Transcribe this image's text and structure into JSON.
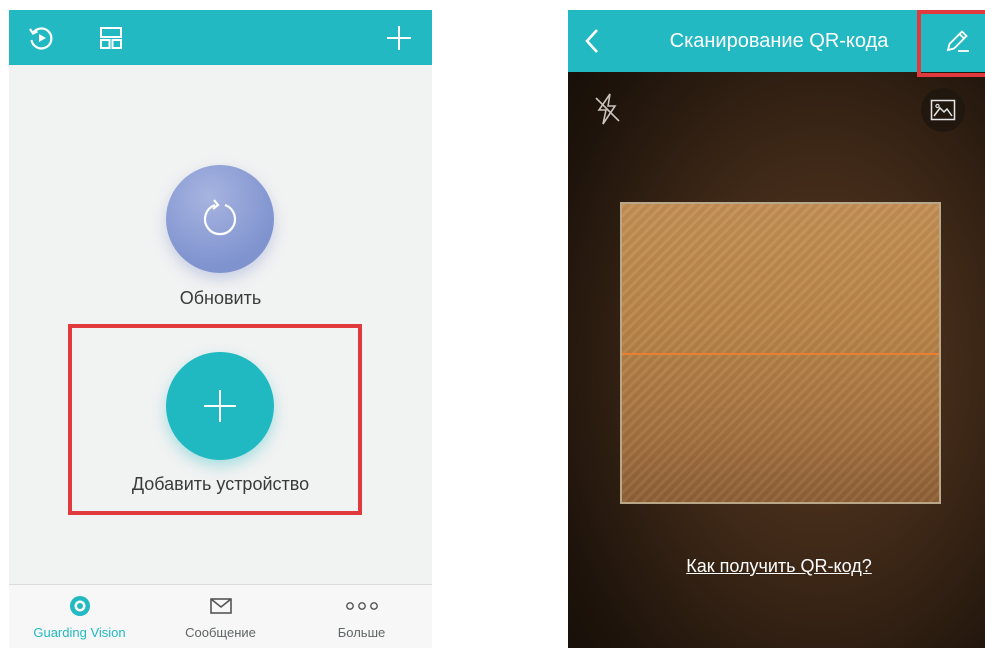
{
  "left_screen": {
    "top_bar": {
      "icons": [
        "playback-icon",
        "layout-icon",
        "add-icon"
      ]
    },
    "refresh": {
      "label": "Обновить",
      "icon": "refresh-icon"
    },
    "add_device": {
      "label": "Добавить устройство",
      "icon": "plus-icon"
    },
    "bottom_nav": {
      "items": [
        {
          "label": "Guarding Vision",
          "icon": "guarding-vision-icon",
          "active": true
        },
        {
          "label": "Сообщение",
          "icon": "envelope-icon",
          "active": false
        },
        {
          "label": "Больше",
          "icon": "more-dots-icon",
          "active": false
        }
      ]
    }
  },
  "right_screen": {
    "header": {
      "title": "Сканирование QR-кода"
    },
    "icons": [
      "back-icon",
      "edit-pencil-icon",
      "flash-off-icon",
      "gallery-icon"
    ],
    "help_link": "Как получить QR-код?"
  },
  "colors": {
    "accent": "#22b9c3",
    "highlight": "#e03a3f",
    "scan_line": "#f2802f",
    "active_nav": "#22b9c3"
  }
}
